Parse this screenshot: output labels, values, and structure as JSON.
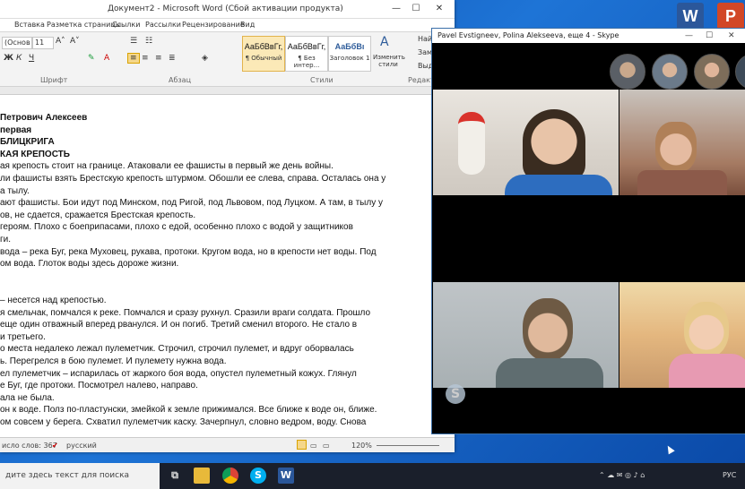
{
  "word": {
    "title": "Документ2 - Microsoft Word (Сбой активации продукта)",
    "tabs": [
      "Вставка",
      "Разметка страницы",
      "Ссылки",
      "Рассылки",
      "Рецензирование",
      "Вид"
    ],
    "font_name": "(Основ",
    "font_size": "11",
    "styles": [
      {
        "preview": "АаБбВвГг,",
        "name": "¶ Обычный"
      },
      {
        "preview": "АаБбВвГг,",
        "name": "¶ Без интер..."
      },
      {
        "preview": "АаБбВı",
        "name": "Заголовок 1"
      }
    ],
    "change_styles": "Изменить стили",
    "right_group": [
      "Найт",
      "Заме",
      "Выде"
    ],
    "group_labels": {
      "font": "Шрифт",
      "paragraph": "Абзац",
      "styles": "Стили",
      "editing": "Редакти"
    },
    "document_lines": [
      {
        "text": "Петрович Алексеев",
        "bold": true
      },
      {
        "text": "первая",
        "bold": true
      },
      {
        "text": "БЛИЦКРИГА",
        "bold": true
      },
      {
        "text": "КАЯ КРЕПОСТЬ",
        "bold": true
      },
      {
        "text": "ая крепость стоит на границе. Атаковали ее фашисты в первый же день войны.",
        "bold": false
      },
      {
        "text": "ли фашисты взять Брестскую крепость штурмом. Обошли ее слева, справа. Осталась она у",
        "bold": false
      },
      {
        "text": "а тылу.",
        "bold": false
      },
      {
        "text": "ают фашисты. Бои идут под Минском, под Ригой, под Львовом, под Луцком. А там, в тылу у",
        "bold": false
      },
      {
        "text": "ов, не сдается, сражается Брестская крепость.",
        "bold": false
      },
      {
        "text": "героям. Плохо с боеприпасами, плохо с едой, особенно плохо с водой у защитников",
        "bold": false
      },
      {
        "text": "ги.",
        "bold": false
      },
      {
        "text": "вода – река Буг, река Муховец, рукава, протоки. Кругом вода, но в крепости нет воды. Под",
        "bold": false
      },
      {
        "text": "ом вода. Глоток воды здесь дороже жизни.",
        "bold": false
      },
      {
        "text": "",
        "bold": false
      },
      {
        "text": "",
        "bold": false
      },
      {
        "text": "– несется над крепостью.",
        "bold": false
      },
      {
        "text": "я смельчак, помчался к реке. Помчался и сразу рухнул. Сразили враги солдата. Прошло",
        "bold": false
      },
      {
        "text": "еще один отважный вперед рванулся. И он погиб. Третий сменил второго. Не стало в",
        "bold": false
      },
      {
        "text": "и третьего.",
        "bold": false
      },
      {
        "text": "о места недалеко лежал пулеметчик. Строчил, строчил пулемет, и вдруг оборвалась",
        "bold": false
      },
      {
        "text": "ь. Перегрелся в бою пулемет. И пулемету нужна вода.",
        "bold": false
      },
      {
        "text": "ел пулеметчик – испарилась от жаркого боя вода, опустел пулеметный кожух. Глянул",
        "bold": false
      },
      {
        "text": "е Буг, где протоки. Посмотрел налево, направо.",
        "bold": false
      },
      {
        "text": "ала не была.",
        "bold": false
      },
      {
        "text": "он к воде. Полз по-пластунски, змейкой к земле прижимался. Все ближе к воде он, ближе.",
        "bold": false
      },
      {
        "text": "ом совсем у берега. Схватил пулеметчик каску. Зачерпнул, словно ведром, воду. Снова",
        "bold": false
      }
    ],
    "status": {
      "words": "исло слов: 367",
      "language": "русский",
      "zoom": "120%"
    }
  },
  "skype": {
    "title": "Pavel Evstigneev, Polina Alekseeva, еще 4 - Skype"
  },
  "desktop_icons": [
    "W",
    "P"
  ],
  "taskbar": {
    "search_placeholder": "дите здесь текст для поиска",
    "lang": "РУС"
  }
}
